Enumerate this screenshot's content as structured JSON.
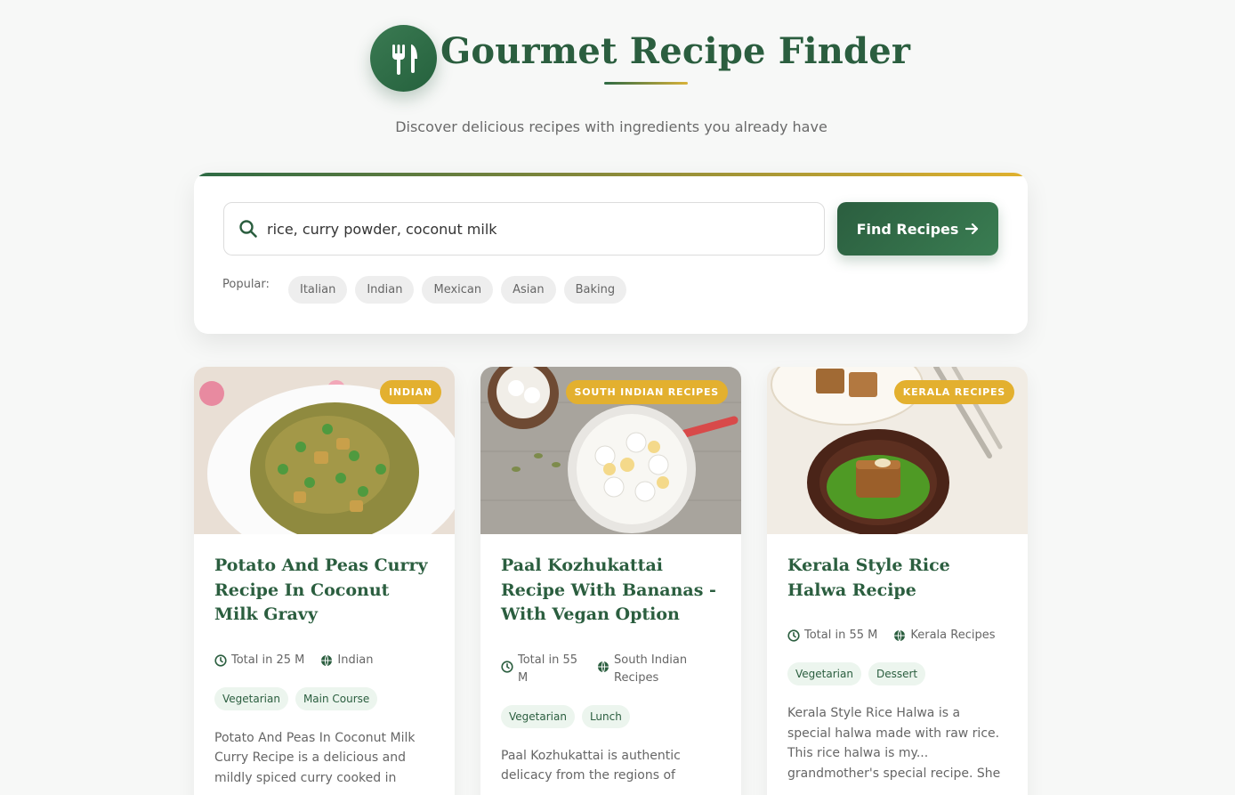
{
  "header": {
    "title": "Gourmet Recipe Finder",
    "subtitle": "Discover delicious recipes with ingredients you already have",
    "logo_icon": "fork-knife-icon"
  },
  "search": {
    "value": "rice, curry powder, coconut milk",
    "button_label": "Find Recipes",
    "popular_label": "Popular:",
    "popular": [
      "Italian",
      "Indian",
      "Mexican",
      "Asian",
      "Baking"
    ]
  },
  "colors": {
    "primary": "#2b5e3f",
    "accent": "#e3b02f",
    "tag_bg": "#ecf5ee"
  },
  "recipes": [
    {
      "badge": "INDIAN",
      "title": "Potato And Peas Curry Recipe In Coconut Milk Gravy",
      "time": "Total in 25 M",
      "cuisine": "Indian",
      "tags": [
        "Vegetarian",
        "Main Course"
      ],
      "description": "Potato And Peas In Coconut Milk Curry Recipe is a delicious and mildly spiced curry cooked in"
    },
    {
      "badge": "SOUTH INDIAN RECIPES",
      "title": "Paal Kozhukattai Recipe With Bananas - With Vegan Option",
      "time": "Total in 55 M",
      "cuisine": "South Indian Recipes",
      "tags": [
        "Vegetarian",
        "Lunch"
      ],
      "description": "Paal Kozhukattai is authentic delicacy from the regions of"
    },
    {
      "badge": "KERALA RECIPES",
      "title": "Kerala Style Rice Halwa Recipe",
      "time": "Total in 55 M",
      "cuisine": "Kerala Recipes",
      "tags": [
        "Vegetarian",
        "Dessert"
      ],
      "description": "Kerala Style Rice Halwa is a special halwa made with raw rice. This rice halwa is my... grandmother's special recipe. She"
    }
  ]
}
